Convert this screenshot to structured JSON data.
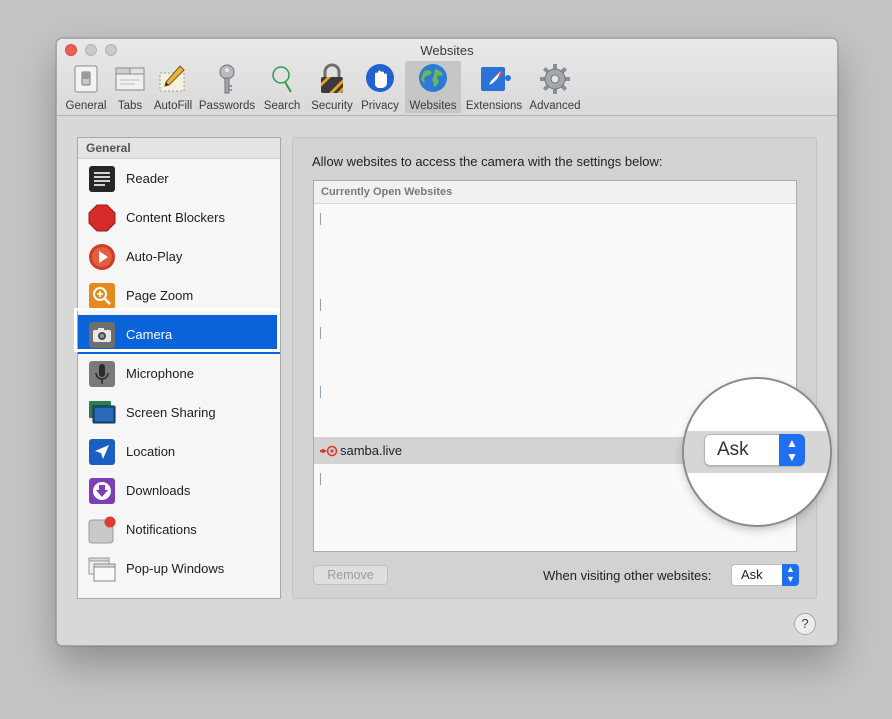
{
  "window": {
    "title": "Websites"
  },
  "toolbar": {
    "items": [
      {
        "label": "General",
        "icon": "general-switch-icon"
      },
      {
        "label": "Tabs",
        "icon": "tabs-icon"
      },
      {
        "label": "AutoFill",
        "icon": "autofill-pencil-icon"
      },
      {
        "label": "Passwords",
        "icon": "key-icon"
      },
      {
        "label": "Search",
        "icon": "search-magnifier-icon"
      },
      {
        "label": "Security",
        "icon": "lock-icon"
      },
      {
        "label": "Privacy",
        "icon": "hand-icon"
      },
      {
        "label": "Websites",
        "icon": "globe-icon"
      },
      {
        "label": "Extensions",
        "icon": "extensions-puzzle-icon"
      },
      {
        "label": "Advanced",
        "icon": "gear-icon"
      }
    ],
    "active": "Websites"
  },
  "sidebar": {
    "header": "General",
    "items": [
      {
        "label": "Reader",
        "icon": "reader-icon"
      },
      {
        "label": "Content Blockers",
        "icon": "stop-sign-icon"
      },
      {
        "label": "Auto-Play",
        "icon": "play-icon"
      },
      {
        "label": "Page Zoom",
        "icon": "zoom-icon"
      },
      {
        "label": "Camera",
        "icon": "camera-icon"
      },
      {
        "label": "Microphone",
        "icon": "microphone-icon"
      },
      {
        "label": "Screen Sharing",
        "icon": "screen-sharing-icon"
      },
      {
        "label": "Location",
        "icon": "location-arrow-icon"
      },
      {
        "label": "Downloads",
        "icon": "download-icon"
      },
      {
        "label": "Notifications",
        "icon": "notifications-icon"
      },
      {
        "label": "Pop-up Windows",
        "icon": "popup-windows-icon"
      }
    ],
    "selected": "Camera"
  },
  "main": {
    "description": "Allow websites to access the camera with the settings below:",
    "table": {
      "header": "Currently Open Websites",
      "rows": [
        {
          "site": "samba.live",
          "setting": "Ask"
        }
      ]
    },
    "remove_label": "Remove",
    "other_websites_label": "When visiting other websites:",
    "other_websites_value": "Ask"
  },
  "magnifier": {
    "value": "Ask"
  },
  "help": "?",
  "colors": {
    "selection": "#0a63d8",
    "stepper": "#1f6ff0"
  }
}
